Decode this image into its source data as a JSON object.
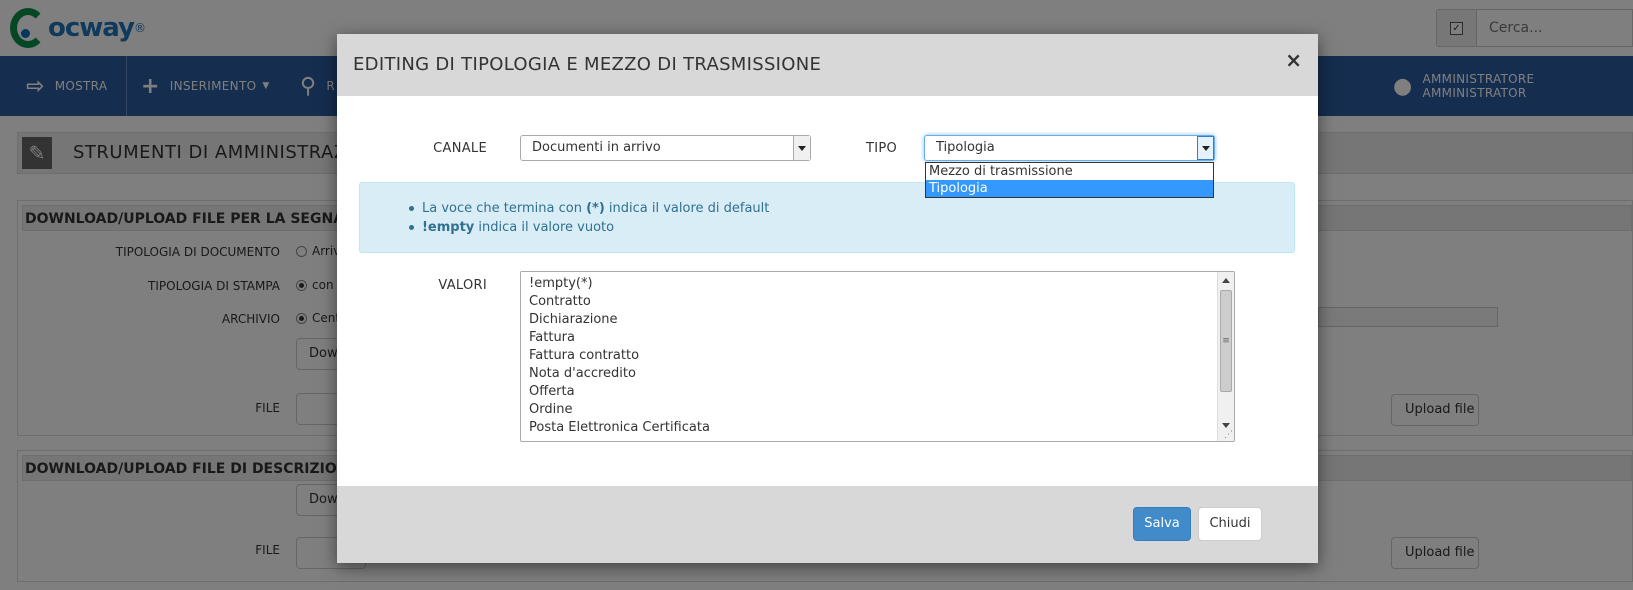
{
  "app": {
    "logo_text": "ocway",
    "logo_reg": "®",
    "search_placeholder": "Cerca...",
    "search_check": "✓"
  },
  "nav": {
    "mostra": "MOSTRA",
    "inserimento": "INSERIMENTO",
    "third_partial": "R",
    "user": "AMMINISTRATORE AMMINISTRATOR"
  },
  "page": {
    "tools_title": "STRUMENTI DI AMMINISTRAZI",
    "panel1_title": "DOWNLOAD/UPLOAD FILE PER LA SEGNATUR",
    "panel1_right_title": "",
    "tipologia_documento_label": "TIPOLOGIA DI DOCUMENTO",
    "tipologia_documento_value": "Arriv",
    "tipologia_stampa_label": "TIPOLOGIA DI STAMPA",
    "tipologia_stampa_value": "con",
    "archivio_label": "ARCHIVIO",
    "archivio_value": "Cent",
    "download_btn": "Dowr",
    "file_label": "FILE",
    "upload_btn": "Upload file",
    "panel2_title": "DOWNLOAD/UPLOAD FILE DI DESCRIZIONE D",
    "download2_btn": "Dowr",
    "file2_label": "FILE",
    "upload2_btn": "Upload file"
  },
  "modal": {
    "title": "EDITING DI TIPOLOGIA E MEZZO DI TRASMISSIONE",
    "close": "×",
    "canale_label": "CANALE",
    "canale_value": "Documenti in arrivo",
    "tipo_label": "TIPO",
    "tipo_value": "Tipologia",
    "tipo_options": [
      "Mezzo di trasmissione",
      "Tipologia"
    ],
    "tipo_selected_index": 1,
    "info": {
      "line1_pre": "La voce che termina con ",
      "line1_bold": "(*)",
      "line1_post": " indica il valore di default",
      "line2_bold": "!empty",
      "line2_post": " indica il valore vuoto"
    },
    "valori_label": "VALORI",
    "valori": [
      "!empty(*)",
      "Contratto",
      "Dichiarazione",
      "Fattura",
      "Fattura contratto",
      "Nota d'accredito",
      "Offerta",
      "Ordine",
      "Posta Elettronica Certificata"
    ],
    "save_button": "Salva",
    "close_button": "Chiudi"
  }
}
